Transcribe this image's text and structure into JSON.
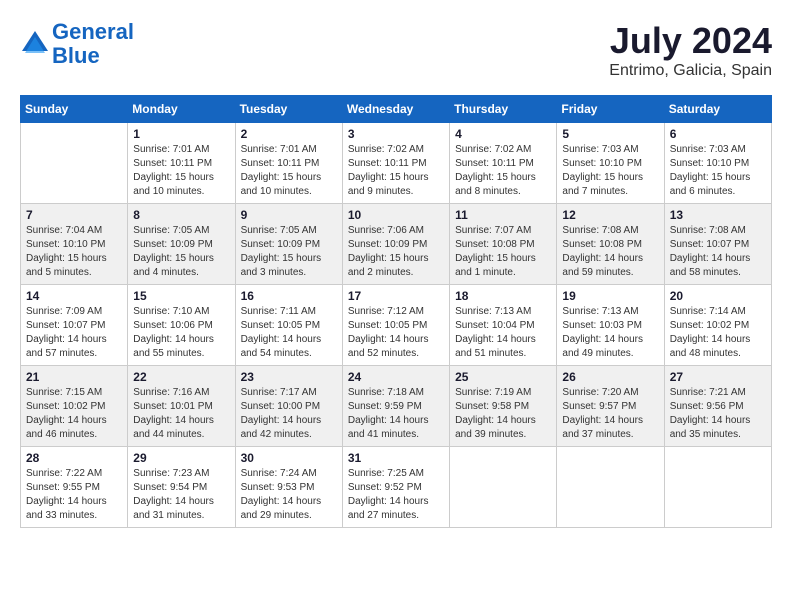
{
  "logo": {
    "line1": "General",
    "line2": "Blue"
  },
  "title": "July 2024",
  "subtitle": "Entrimo, Galicia, Spain",
  "weekdays": [
    "Sunday",
    "Monday",
    "Tuesday",
    "Wednesday",
    "Thursday",
    "Friday",
    "Saturday"
  ],
  "weeks": [
    [
      {
        "day": "",
        "info": ""
      },
      {
        "day": "1",
        "info": "Sunrise: 7:01 AM\nSunset: 10:11 PM\nDaylight: 15 hours\nand 10 minutes."
      },
      {
        "day": "2",
        "info": "Sunrise: 7:01 AM\nSunset: 10:11 PM\nDaylight: 15 hours\nand 10 minutes."
      },
      {
        "day": "3",
        "info": "Sunrise: 7:02 AM\nSunset: 10:11 PM\nDaylight: 15 hours\nand 9 minutes."
      },
      {
        "day": "4",
        "info": "Sunrise: 7:02 AM\nSunset: 10:11 PM\nDaylight: 15 hours\nand 8 minutes."
      },
      {
        "day": "5",
        "info": "Sunrise: 7:03 AM\nSunset: 10:10 PM\nDaylight: 15 hours\nand 7 minutes."
      },
      {
        "day": "6",
        "info": "Sunrise: 7:03 AM\nSunset: 10:10 PM\nDaylight: 15 hours\nand 6 minutes."
      }
    ],
    [
      {
        "day": "7",
        "info": "Sunrise: 7:04 AM\nSunset: 10:10 PM\nDaylight: 15 hours\nand 5 minutes."
      },
      {
        "day": "8",
        "info": "Sunrise: 7:05 AM\nSunset: 10:09 PM\nDaylight: 15 hours\nand 4 minutes."
      },
      {
        "day": "9",
        "info": "Sunrise: 7:05 AM\nSunset: 10:09 PM\nDaylight: 15 hours\nand 3 minutes."
      },
      {
        "day": "10",
        "info": "Sunrise: 7:06 AM\nSunset: 10:09 PM\nDaylight: 15 hours\nand 2 minutes."
      },
      {
        "day": "11",
        "info": "Sunrise: 7:07 AM\nSunset: 10:08 PM\nDaylight: 15 hours\nand 1 minute."
      },
      {
        "day": "12",
        "info": "Sunrise: 7:08 AM\nSunset: 10:08 PM\nDaylight: 14 hours\nand 59 minutes."
      },
      {
        "day": "13",
        "info": "Sunrise: 7:08 AM\nSunset: 10:07 PM\nDaylight: 14 hours\nand 58 minutes."
      }
    ],
    [
      {
        "day": "14",
        "info": "Sunrise: 7:09 AM\nSunset: 10:07 PM\nDaylight: 14 hours\nand 57 minutes."
      },
      {
        "day": "15",
        "info": "Sunrise: 7:10 AM\nSunset: 10:06 PM\nDaylight: 14 hours\nand 55 minutes."
      },
      {
        "day": "16",
        "info": "Sunrise: 7:11 AM\nSunset: 10:05 PM\nDaylight: 14 hours\nand 54 minutes."
      },
      {
        "day": "17",
        "info": "Sunrise: 7:12 AM\nSunset: 10:05 PM\nDaylight: 14 hours\nand 52 minutes."
      },
      {
        "day": "18",
        "info": "Sunrise: 7:13 AM\nSunset: 10:04 PM\nDaylight: 14 hours\nand 51 minutes."
      },
      {
        "day": "19",
        "info": "Sunrise: 7:13 AM\nSunset: 10:03 PM\nDaylight: 14 hours\nand 49 minutes."
      },
      {
        "day": "20",
        "info": "Sunrise: 7:14 AM\nSunset: 10:02 PM\nDaylight: 14 hours\nand 48 minutes."
      }
    ],
    [
      {
        "day": "21",
        "info": "Sunrise: 7:15 AM\nSunset: 10:02 PM\nDaylight: 14 hours\nand 46 minutes."
      },
      {
        "day": "22",
        "info": "Sunrise: 7:16 AM\nSunset: 10:01 PM\nDaylight: 14 hours\nand 44 minutes."
      },
      {
        "day": "23",
        "info": "Sunrise: 7:17 AM\nSunset: 10:00 PM\nDaylight: 14 hours\nand 42 minutes."
      },
      {
        "day": "24",
        "info": "Sunrise: 7:18 AM\nSunset: 9:59 PM\nDaylight: 14 hours\nand 41 minutes."
      },
      {
        "day": "25",
        "info": "Sunrise: 7:19 AM\nSunset: 9:58 PM\nDaylight: 14 hours\nand 39 minutes."
      },
      {
        "day": "26",
        "info": "Sunrise: 7:20 AM\nSunset: 9:57 PM\nDaylight: 14 hours\nand 37 minutes."
      },
      {
        "day": "27",
        "info": "Sunrise: 7:21 AM\nSunset: 9:56 PM\nDaylight: 14 hours\nand 35 minutes."
      }
    ],
    [
      {
        "day": "28",
        "info": "Sunrise: 7:22 AM\nSunset: 9:55 PM\nDaylight: 14 hours\nand 33 minutes."
      },
      {
        "day": "29",
        "info": "Sunrise: 7:23 AM\nSunset: 9:54 PM\nDaylight: 14 hours\nand 31 minutes."
      },
      {
        "day": "30",
        "info": "Sunrise: 7:24 AM\nSunset: 9:53 PM\nDaylight: 14 hours\nand 29 minutes."
      },
      {
        "day": "31",
        "info": "Sunrise: 7:25 AM\nSunset: 9:52 PM\nDaylight: 14 hours\nand 27 minutes."
      },
      {
        "day": "",
        "info": ""
      },
      {
        "day": "",
        "info": ""
      },
      {
        "day": "",
        "info": ""
      }
    ]
  ]
}
